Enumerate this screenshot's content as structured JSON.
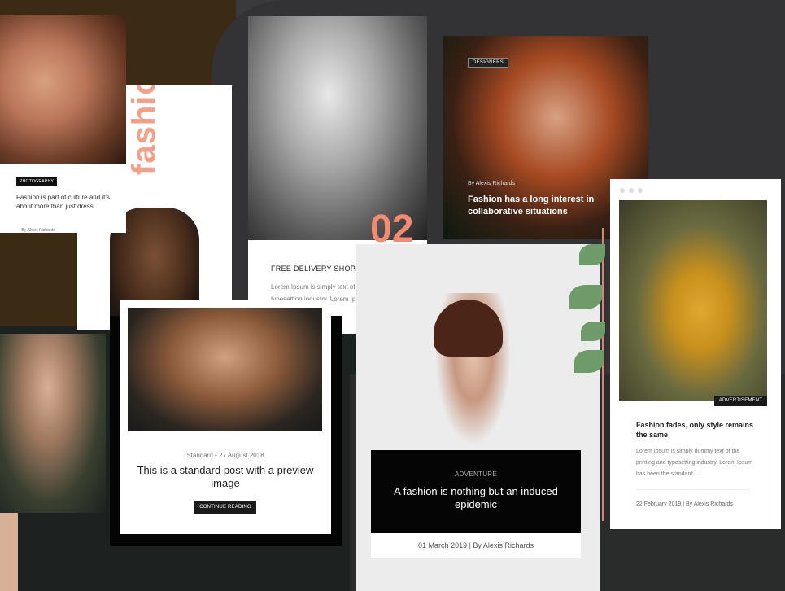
{
  "card_photography": {
    "badge": "PHOTOGRAPHY",
    "title": "Fashion is part of culture and it's about more than just dress",
    "meta": "—   By Alexis Richards"
  },
  "card_fashion": {
    "word": "fashio"
  },
  "card_delivery": {
    "number": "02",
    "heading": "FREE DELIVERY SHOPPING",
    "text": "Lorem Ipsum is simply text of the printing and typesetting industry. Lorem Ipsum has been"
  },
  "card_designers": {
    "badge": "DESIGNERS",
    "byline": "By Alexis Richards",
    "title": "Fashion has a long interest in collaborative situations"
  },
  "card_standard": {
    "meta": "Standard   •   27 August 2018",
    "title": "This is a standard post with a preview image",
    "button": "CONTINUE READING"
  },
  "card_adventure": {
    "category": "ADVENTURE",
    "title": "A fashion is nothing but an induced epidemic",
    "footer": "01 March 2019   |   By Alexis Richards"
  },
  "card_ad": {
    "badge": "ADVERTISEMENT",
    "title": "Fashion fades, only style remains the same",
    "text": "Lorem Ipsum is simply dummy text of the printing and typesetting industry. Lorem Ipsum has been the standard....",
    "meta": "22 February 2019   |   By Alexis Richards"
  },
  "colors": {
    "accent_coral": "#f58a73",
    "dark": "#050505",
    "ochre": "#e0a830"
  }
}
